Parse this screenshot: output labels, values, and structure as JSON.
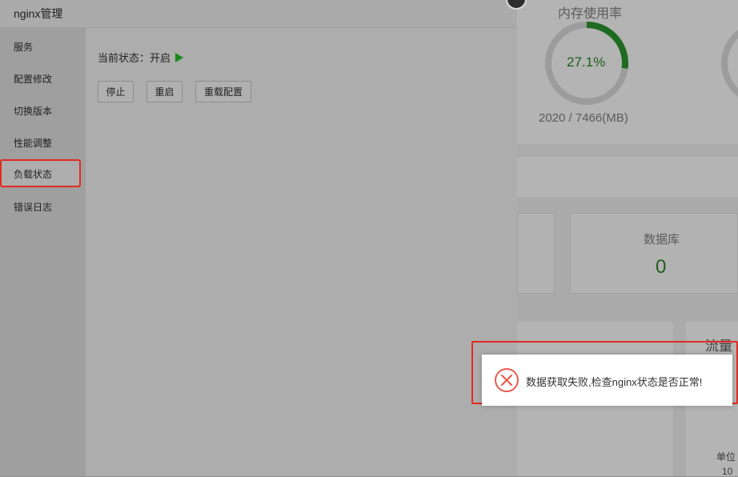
{
  "modal": {
    "title": "nginx管理",
    "sidebar": {
      "items": [
        {
          "label": "服务"
        },
        {
          "label": "配置修改"
        },
        {
          "label": "切换版本"
        },
        {
          "label": "性能调整"
        },
        {
          "label": "负载状态",
          "active": true
        },
        {
          "label": "错误日志"
        }
      ]
    },
    "status": {
      "text": "当前状态：开启",
      "running": true
    },
    "buttons": {
      "stop": "停止",
      "restart": "重启",
      "reload": "重载配置"
    }
  },
  "background": {
    "memory": {
      "title": "内存使用率",
      "percent_text": "27.1%",
      "percent": 27.1,
      "detail": "2020 / 7466(MB)"
    },
    "database": {
      "label": "数据库",
      "count": "0"
    },
    "flow": {
      "label": "流量",
      "unit_label": "单位",
      "unit_value": "10"
    }
  },
  "toast": {
    "message": "数据获取失败,检查nginx状态是否正常!",
    "icon": "error-circle-x-icon",
    "color": "#e85a4f"
  }
}
